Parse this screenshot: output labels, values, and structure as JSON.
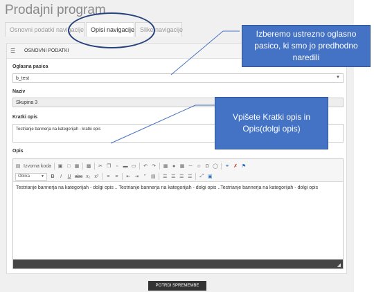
{
  "page": {
    "title": "Prodajni program"
  },
  "tabs": [
    {
      "label": "Osnovni podatki navigacije",
      "active": false
    },
    {
      "label": "Opisi navigacije",
      "active": true
    },
    {
      "label": "Slike navigacije",
      "active": false
    }
  ],
  "card": {
    "header_icon": "list-icon",
    "header_label": "OSNOVNI PODATKI"
  },
  "form": {
    "oglasna_label": "Oglasna pasica",
    "oglasna_value": "b_test",
    "naziv_label": "Naziv",
    "naziv_value": "Skupina 3",
    "kratki_label": "Kratki opis",
    "kratki_value": "Testrianje bannerja na kategorijah - kratki opis",
    "opis_label": "Opis"
  },
  "editor": {
    "source_label": "Izvorna koda",
    "format_select": "Oblika",
    "content": "Testrianje bannerja na kategorijah - dolgi opis .. Testrianje bannerja na kategorijah - dolgi opis ..Testrianje bannerja na kategorijah - dolgi opis"
  },
  "save_button": "POTRDI SPREMEMBE",
  "callouts": [
    "Izberemo ustrezno oglasno pasico, ki smo jo predhodno naredili",
    "Vpišete Kratki opis in Opis(dolgi opis)"
  ],
  "colors": {
    "callout_fill": "#4472c4",
    "oval_stroke": "#26417c",
    "editor_footer": "#444444"
  }
}
